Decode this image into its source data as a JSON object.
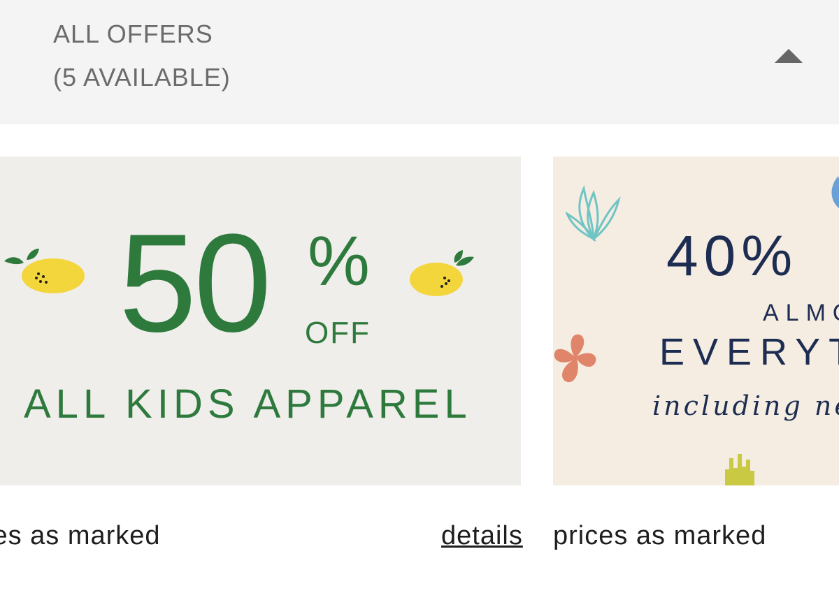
{
  "offers_header": {
    "title": "ALL OFFERS",
    "count_label": "(5 AVAILABLE)",
    "toggle_icon": "caret-up-icon"
  },
  "offers": [
    {
      "banner": {
        "percent_number": "50",
        "percent_sign": "%",
        "off_text": "OFF",
        "headline": "ALL KIDS APPAREL",
        "accent_color": "#2e7a3d",
        "background_color": "#f0eeeb",
        "decoration_icon": "lemon-icon"
      },
      "caption": "ices as marked",
      "details_link": "details"
    },
    {
      "banner": {
        "percent_text": "40%",
        "line2": "ALMO",
        "line3": "EVERYT",
        "line4": "including ne",
        "accent_color": "#1d2d52",
        "background_color": "#f6ede2",
        "decoration_icon": "leaf-icon"
      },
      "caption": "prices as marked"
    }
  ]
}
